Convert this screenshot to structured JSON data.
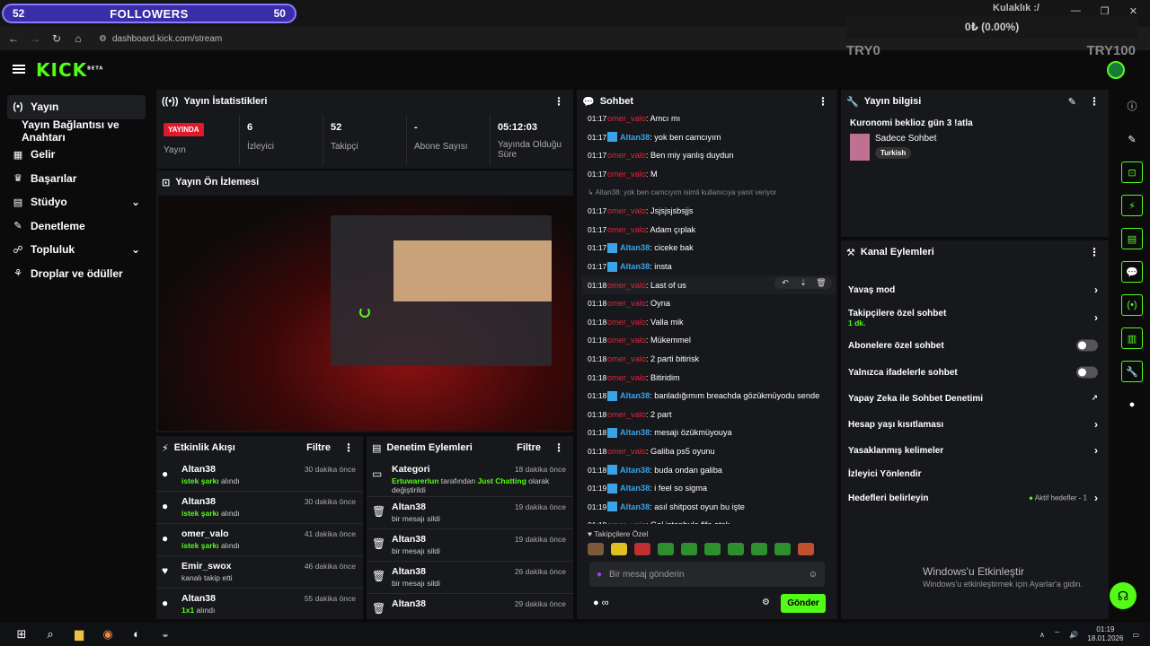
{
  "overlay": {
    "left_count": "52",
    "title": "FOLLOWERS",
    "right_count": "50"
  },
  "browser": {
    "url": "dashboard.kick.com/stream"
  },
  "donation_overlay": {
    "title": "Kulaklık :/",
    "amount": "0₺ (0.00%)",
    "left": "TRY0",
    "right": "TRY100"
  },
  "kick": {
    "logo": "KICK",
    "beta": "BETA"
  },
  "nav": {
    "items": [
      {
        "label": "Yayın",
        "icon": "(•)"
      },
      {
        "label": "Yayın Bağlantısı ve Anahtarı"
      },
      {
        "label": "Gelir",
        "icon": "▦"
      },
      {
        "label": "Başarılar",
        "icon": "♛"
      },
      {
        "label": "Stüdyo",
        "icon": "▤"
      },
      {
        "label": "Denetleme",
        "icon": "✎"
      },
      {
        "label": "Topluluk",
        "icon": "☍"
      },
      {
        "label": "Droplar ve ödüller",
        "icon": "⚘"
      }
    ]
  },
  "stats": {
    "title": "Yayın İstatistikleri",
    "live_badge": "YAYINDA",
    "items": [
      {
        "value": "",
        "label": "Yayın"
      },
      {
        "value": "6",
        "label": "İzleyici"
      },
      {
        "value": "52",
        "label": "Takipçi"
      },
      {
        "value": "-",
        "label": "Abone Sayısı"
      },
      {
        "value": "05:12:03",
        "label": "Yayında Olduğu Süre"
      }
    ]
  },
  "preview": {
    "title": "Yayın Ön İzlemesi"
  },
  "activity": {
    "title": "Etkinlik Akışı",
    "filter": "Filtre",
    "items": [
      {
        "name": "Altan38",
        "sub_hl": "istek şarkı",
        "sub": " alındı",
        "time": "30 dakika önce"
      },
      {
        "name": "Altan38",
        "sub_hl": "istek şarkı",
        "sub": " alındı",
        "time": "30 dakika önce"
      },
      {
        "name": "omer_valo",
        "sub_hl": "istek şarkı",
        "sub": " alındı",
        "time": "41 dakika önce"
      },
      {
        "name": "Emir_swox",
        "sub_hl": "",
        "sub": "kanalı takip etti",
        "time": "46 dakika önce"
      },
      {
        "name": "Altan38",
        "sub_hl": "1x1",
        "sub": " alındı",
        "time": "55 dakika önce"
      }
    ]
  },
  "moderation": {
    "title": "Denetim Eylemleri",
    "filter": "Filtre",
    "items": [
      {
        "name": "Kategori",
        "sub_a": "Ertuwarerlun",
        "sub_b": " tarafından ",
        "sub_c": "Just Chatting",
        "sub_d": " olarak değiştirildi",
        "time": "18 dakika önce"
      },
      {
        "name": "Altan38",
        "sub": "bir mesajı sildi",
        "time": "19 dakika önce"
      },
      {
        "name": "Altan38",
        "sub": "bir mesajı sildi",
        "time": "19 dakika önce"
      },
      {
        "name": "Altan38",
        "sub": "bir mesajı sildi",
        "time": "26 dakika önce"
      },
      {
        "name": "Altan38",
        "sub": "",
        "time": "29 dakika önce"
      }
    ]
  },
  "chat": {
    "title": "Sohbet",
    "messages": [
      {
        "time": "01:17",
        "user": "omer_valo",
        "type": "u2",
        "text": ": Amcı mı"
      },
      {
        "time": "01:17",
        "user": "Altan38",
        "type": "u1",
        "text": ": yok ben camcıyım"
      },
      {
        "time": "01:17",
        "user": "omer_valo",
        "type": "u2",
        "text": ": Ben miy yanlış duydun"
      },
      {
        "time": "01:17",
        "user": "omer_valo",
        "type": "u2",
        "text": ": M"
      },
      {
        "reply": "↳ Altan38: yok ben camcıyım isimli kullanıcıya yanıt veriyor"
      },
      {
        "time": "01:17",
        "user": "omer_valo",
        "type": "u2",
        "text": ": Jsjsjsjsbsjjs"
      },
      {
        "time": "01:17",
        "user": "omer_valo",
        "type": "u2",
        "text": ": Adam çıplak"
      },
      {
        "time": "01:17",
        "user": "Altan38",
        "type": "u1",
        "text": ": ciceke bak"
      },
      {
        "time": "01:17",
        "user": "Altan38",
        "type": "u1",
        "text": ": insta"
      },
      {
        "time": "01:18",
        "user": "omer_valo",
        "type": "u2",
        "text": ": Last of us",
        "hl": true
      },
      {
        "time": "01:18",
        "user": "omer_valo",
        "type": "u2",
        "text": ": Oyna"
      },
      {
        "time": "01:18",
        "user": "omer_valo",
        "type": "u2",
        "text": ": Valla mik"
      },
      {
        "time": "01:18",
        "user": "omer_valo",
        "type": "u2",
        "text": ": Mükemmel"
      },
      {
        "time": "01:18",
        "user": "omer_valo",
        "type": "u2",
        "text": ": 2 parti bitirisk"
      },
      {
        "time": "01:18",
        "user": "omer_valo",
        "type": "u2",
        "text": ": Bitiridim"
      },
      {
        "time": "01:18",
        "user": "Altan38",
        "type": "u1",
        "text": ": banladığımım breachda gözükmüyodu sende"
      },
      {
        "time": "01:18",
        "user": "omer_valo",
        "type": "u2",
        "text": ": 2 part"
      },
      {
        "time": "01:18",
        "user": "Altan38",
        "type": "u1",
        "text": ": mesajı özükmüyouya"
      },
      {
        "time": "01:18",
        "user": "omer_valo",
        "type": "u2",
        "text": ": Galiba ps5 oyunu"
      },
      {
        "time": "01:18",
        "user": "Altan38",
        "type": "u1",
        "text": ": buda ondan galiba"
      },
      {
        "time": "01:19",
        "user": "Altan38",
        "type": "u1",
        "text": ": i feel so sigma"
      },
      {
        "time": "01:19",
        "user": "Altan38",
        "type": "u1",
        "text": ": asıl shitpost oyun bu işte"
      },
      {
        "time": "01:19",
        "user": "omer_valo",
        "type": "u2",
        "text": ": Gel istanbula fifa atak"
      }
    ],
    "emote_label": "♥ Takipçilere Özel",
    "placeholder": "Bir mesaj gönderin",
    "send": "Gönder"
  },
  "stream_info": {
    "title": "Yayın bilgisi",
    "stream_title": "Kuronomi beklioz gün 3 !atla",
    "category": "Sadece Sohbet",
    "tag": "Turkish"
  },
  "channel_actions": {
    "title": "Kanal Eylemleri",
    "items": [
      {
        "label": "Yavaş mod",
        "control": "chevron"
      },
      {
        "label": "Takipçilere özel sohbet",
        "sub": "1 dk.",
        "control": "chevron"
      },
      {
        "label": "Abonelere özel sohbet",
        "control": "toggle"
      },
      {
        "label": "Yalnızca ifadelerle sohbet",
        "control": "toggle"
      },
      {
        "label": "Yapay Zeka ile Sohbet Denetimi",
        "control": "external"
      },
      {
        "label": "Hesap yaşı kısıtlaması",
        "control": "chevron"
      },
      {
        "label": "Yasaklanmış kelimeler",
        "control": "chevron"
      },
      {
        "label": "İzleyici Yönlendir",
        "control": "none"
      },
      {
        "label": "Hedefleri belirleyin",
        "control": "goals",
        "extra": "Aktif hedefler - 1"
      }
    ]
  },
  "windows": {
    "watermark_1": "Windows'u Etkinleştir",
    "watermark_2": "Windows'u etkinleştirmek için Ayarlar'a gidin.",
    "time": "01:19",
    "date": "18.01.2026"
  }
}
